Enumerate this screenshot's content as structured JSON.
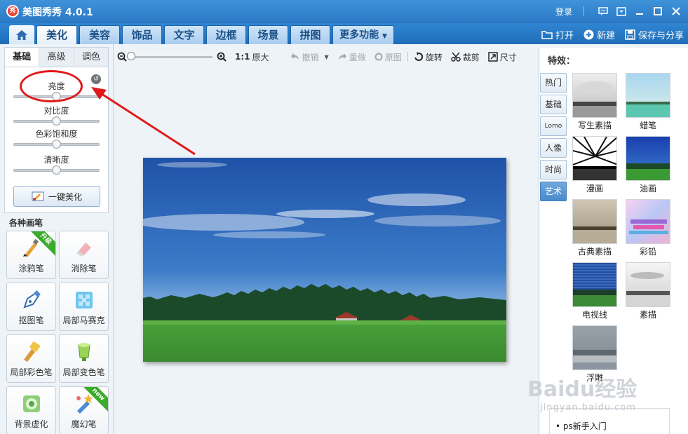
{
  "titlebar": {
    "logo_text": "秀",
    "app_title": "美图秀秀 4.0.1",
    "login": "登录"
  },
  "main_tabs": [
    "美化",
    "美容",
    "饰品",
    "文字",
    "边框",
    "场景",
    "拼图"
  ],
  "more_tab": "更多功能",
  "actions": {
    "open": "打开",
    "new": "新建",
    "save_share": "保存与分享"
  },
  "adjust": {
    "tabs": [
      "基础",
      "高级",
      "调色"
    ],
    "sliders": [
      {
        "label": "亮度",
        "value": 0.5
      },
      {
        "label": "对比度",
        "value": 0.5
      },
      {
        "label": "色彩饱和度",
        "value": 0.5
      },
      {
        "label": "清晰度",
        "value": 0.5
      }
    ],
    "auto_button": "一键美化"
  },
  "brushes": {
    "title": "各种画笔",
    "items": [
      {
        "label": "涂鸦笔",
        "badge": "升级"
      },
      {
        "label": "消除笔"
      },
      {
        "label": "抠图笔"
      },
      {
        "label": "局部马赛克"
      },
      {
        "label": "局部彩色笔"
      },
      {
        "label": "局部变色笔"
      },
      {
        "label": "背景虚化"
      },
      {
        "label": "魔幻笔",
        "badge": "new"
      }
    ]
  },
  "toolbar": {
    "zoom_value": 0.0,
    "ratio_prefix": "1:1",
    "ratio_label": "原大",
    "undo": "撤销",
    "redo": "重做",
    "original": "原图",
    "rotate": "旋转",
    "crop": "裁剪",
    "size": "尺寸"
  },
  "effects": {
    "title": "特效：",
    "categories": [
      "热门",
      "基础",
      "Lomo",
      "人像",
      "时尚",
      "艺术"
    ],
    "active_category": "艺术",
    "items": [
      "写生素描",
      "蜡笔",
      "漫画",
      "油画",
      "古典素描",
      "彩铅",
      "电视线",
      "素描",
      "浮雕"
    ],
    "tips": "ps新手入门"
  },
  "watermark": {
    "main": "Baidu经验",
    "sub": "jingyan.baidu.com"
  },
  "colors": {
    "titlebar": "#2f80cc",
    "annotation": "#e01a1a",
    "accent": "#4a8bcc"
  }
}
